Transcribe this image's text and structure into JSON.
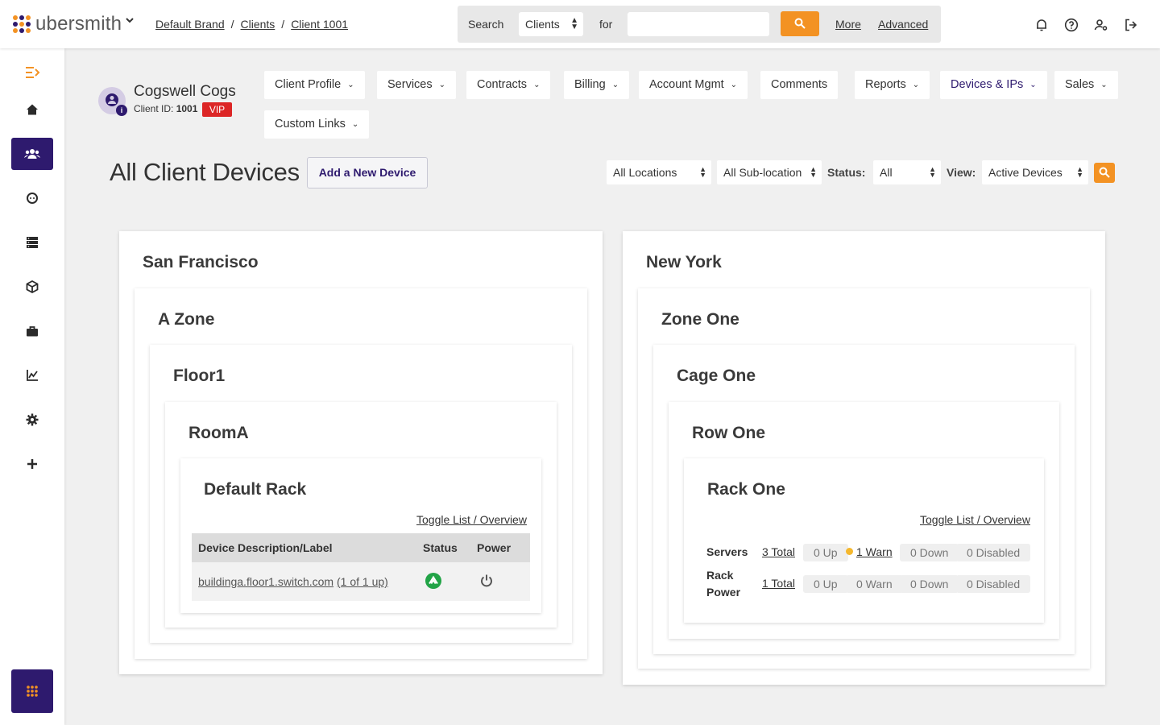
{
  "brand": {
    "name": "ubersmith",
    "dot_colors": [
      "#f39223",
      "#2e1a6e",
      "#f39223",
      "#2e1a6e",
      "#f39223",
      "#2e1a6e",
      "#f39223",
      "#2e1a6e",
      "#f39223"
    ]
  },
  "breadcrumb": [
    "Default Brand",
    "Clients",
    "Client 1001"
  ],
  "search": {
    "label": "Search",
    "scope": "Clients",
    "for_label": "for",
    "value": "",
    "more_label": "More",
    "advanced_label": "Advanced"
  },
  "colors": {
    "accent": "#f39223",
    "primary": "#2e1a6e",
    "vip": "#dc2626",
    "status_up": "#22a447",
    "warn": "#f5b82e"
  },
  "client": {
    "name": "Cogswell Cogs",
    "id_label": "Client ID:",
    "id": "1001",
    "badge": "VIP"
  },
  "tabs": [
    {
      "label": "Client Profile"
    },
    {
      "label": "Services"
    },
    {
      "label": "Contracts"
    },
    {
      "label": "Billing"
    },
    {
      "label": "Account Mgmt"
    },
    {
      "label": "Comments"
    },
    {
      "label": "Reports"
    },
    {
      "label": "Devices & IPs"
    },
    {
      "label": "Sales"
    },
    {
      "label": "Custom Links"
    }
  ],
  "page": {
    "title": "All Client Devices",
    "add_button": "Add a New Device"
  },
  "filters": {
    "location": "All Locations",
    "sublocation": "All Sub-location",
    "status_label": "Status:",
    "status": "All",
    "view_label": "View:",
    "view": "Active Devices"
  },
  "locations": {
    "sf": {
      "name": "San Francisco",
      "zone": "A Zone",
      "floor": "Floor1",
      "room": "RoomA",
      "rack": "Default Rack",
      "toggle": "Toggle List / Overview",
      "columns": [
        "Device Description/Label",
        "Status",
        "Power"
      ],
      "device": {
        "label": "buildinga.floor1.switch.com",
        "count": "(1 of 1 up)"
      }
    },
    "ny": {
      "name": "New York",
      "zone": "Zone One",
      "cage": "Cage One",
      "row": "Row One",
      "rack": "Rack One",
      "toggle": "Toggle List / Overview",
      "servers": {
        "label": "Servers",
        "total": "3 Total",
        "up": "0 Up",
        "warn": "1 Warn",
        "down": "0 Down",
        "disabled": "0 Disabled"
      },
      "rack_power": {
        "label_line1": "Rack",
        "label_line2": "Power",
        "total": "1 Total",
        "up": "0 Up",
        "warn": "0 Warn",
        "down": "0 Down",
        "disabled": "0 Disabled"
      }
    }
  }
}
